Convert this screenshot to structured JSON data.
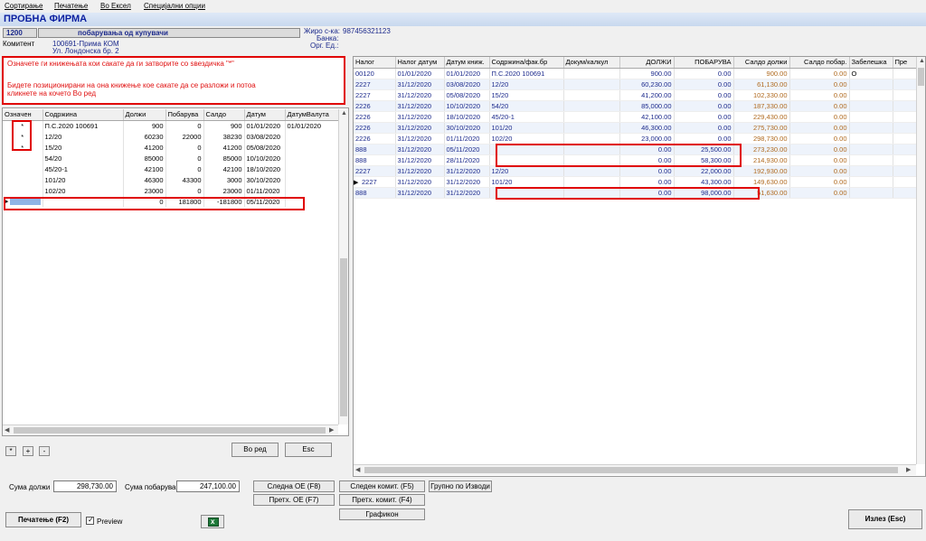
{
  "menu": [
    "Сортирање",
    "Печатење",
    "Во Ексел",
    "Специјални опции"
  ],
  "app_title": "ПРОБНА ФИРМА",
  "header": {
    "account_code": "1200",
    "account_name": "побарувања од купувачи",
    "giro_label": "Жиро с-ка:",
    "giro_value": "987456321123",
    "bank_label": "Банка:",
    "org_label": "Орг. Ед.:",
    "client_label": "Комитент",
    "client_value": "100691-Прима КОМ",
    "client_address": "Ул. Лондонска бр. 2"
  },
  "info": {
    "line1": "Означете ги книжењата кои сакате да ги затворите со ѕвездичка \"*\"",
    "line2": "Бидете позиционирани на она книжење кое сакате да се разложи и потоа",
    "line3": "кликнете на кочето Во ред"
  },
  "left_table": {
    "columns": [
      "Означен",
      "Содржина",
      "Должи",
      "Побарува",
      "Салдо",
      "Датум",
      "ДатумВалута"
    ],
    "rows": [
      [
        "*",
        "П.С.2020 100691",
        "900",
        "0",
        "900",
        "01/01/2020",
        "01/01/2020"
      ],
      [
        "*",
        "12/20",
        "60230",
        "22000",
        "38230",
        "03/08/2020",
        ""
      ],
      [
        "*",
        "15/20",
        "41200",
        "0",
        "41200",
        "05/08/2020",
        ""
      ],
      [
        "",
        "54/20",
        "85000",
        "0",
        "85000",
        "10/10/2020",
        ""
      ],
      [
        "",
        "45/20-1",
        "42100",
        "0",
        "42100",
        "18/10/2020",
        ""
      ],
      [
        "",
        "101/20",
        "46300",
        "43300",
        "3000",
        "30/10/2020",
        ""
      ],
      [
        "",
        "102/20",
        "23000",
        "0",
        "23000",
        "01/11/2020",
        ""
      ],
      [
        "",
        "",
        "0",
        "181800",
        "-181800",
        "05/11/2020",
        ""
      ]
    ]
  },
  "right_table": {
    "columns": [
      "Налог",
      "Налог датум",
      "Датум книж.",
      "Содржина/фак.бр",
      "Докум/калкул",
      "ДОЛЖИ",
      "ПОБАРУВА",
      "Салдо должи",
      "Салдо побар.",
      "Забелешка",
      "Пре"
    ],
    "rows": [
      [
        "00120",
        "01/01/2020",
        "01/01/2020",
        "П.С.2020 100691",
        "",
        "900.00",
        "0.00",
        "900.00",
        "0.00",
        "О",
        ""
      ],
      [
        "2227",
        "31/12/2020",
        "03/08/2020",
        "12/20",
        "",
        "60,230.00",
        "0.00",
        "61,130.00",
        "0.00",
        "",
        ""
      ],
      [
        "2227",
        "31/12/2020",
        "05/08/2020",
        "15/20",
        "",
        "41,200.00",
        "0.00",
        "102,330.00",
        "0.00",
        "",
        ""
      ],
      [
        "2226",
        "31/12/2020",
        "10/10/2020",
        "54/20",
        "",
        "85,000.00",
        "0.00",
        "187,330.00",
        "0.00",
        "",
        ""
      ],
      [
        "2226",
        "31/12/2020",
        "18/10/2020",
        "45/20-1",
        "",
        "42,100.00",
        "0.00",
        "229,430.00",
        "0.00",
        "",
        ""
      ],
      [
        "2226",
        "31/12/2020",
        "30/10/2020",
        "101/20",
        "",
        "46,300.00",
        "0.00",
        "275,730.00",
        "0.00",
        "",
        ""
      ],
      [
        "2226",
        "31/12/2020",
        "01/11/2020",
        "102/20",
        "",
        "23,000.00",
        "0.00",
        "298,730.00",
        "0.00",
        "",
        ""
      ],
      [
        "888",
        "31/12/2020",
        "05/11/2020",
        "",
        "",
        "0.00",
        "25,500.00",
        "273,230.00",
        "0.00",
        "",
        ""
      ],
      [
        "888",
        "31/12/2020",
        "28/11/2020",
        "",
        "",
        "0.00",
        "58,300.00",
        "214,930.00",
        "0.00",
        "",
        ""
      ],
      [
        "2227",
        "31/12/2020",
        "31/12/2020",
        "12/20",
        "",
        "0.00",
        "22,000.00",
        "192,930.00",
        "0.00",
        "",
        ""
      ],
      [
        "2227",
        "31/12/2020",
        "31/12/2020",
        "101/20",
        "",
        "0.00",
        "43,300.00",
        "149,630.00",
        "0.00",
        "",
        ""
      ],
      [
        "888",
        "31/12/2020",
        "31/12/2020",
        "",
        "",
        "0.00",
        "98,000.00",
        "51,630.00",
        "0.00",
        "",
        ""
      ]
    ]
  },
  "small_buttons": [
    "*",
    "+",
    "-"
  ],
  "buttons": {
    "vo_red": "Во ред",
    "esc": "Esc",
    "sledna_oe": "Следна ОЕ (F8)",
    "pretx_oe": "Претх. ОЕ (F7)",
    "sleden_komit": "Следен комит. (F5)",
    "pretx_komit": "Претх. комит. (F4)",
    "grupno": "Групно по Изводи",
    "grafikon": "Графикон",
    "pecatenje": "Печатење (F2)",
    "izlez": "Излез (Esc)"
  },
  "totals": {
    "debit_label": "Сума должи",
    "debit_value": "298,730.00",
    "credit_label": "Сума побарува",
    "credit_value": "247,100.00"
  },
  "preview_label": "Preview"
}
